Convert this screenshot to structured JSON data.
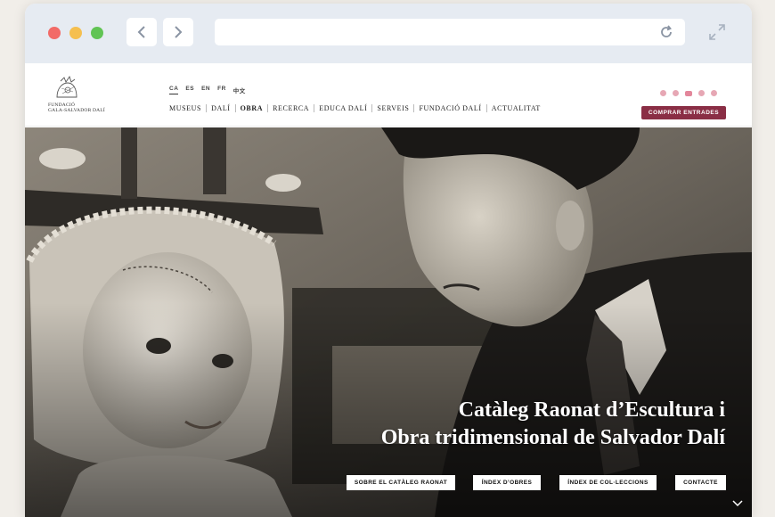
{
  "browser": {
    "icons": [
      "chevron-left-icon",
      "chevron-right-icon",
      "reload-icon",
      "expand-icon"
    ]
  },
  "logo": {
    "line1": "FUNDACIÓ",
    "line2": "GALA-SALVADOR DALÍ"
  },
  "languages": [
    {
      "code": "CA",
      "active": true
    },
    {
      "code": "ES",
      "active": false
    },
    {
      "code": "EN",
      "active": false
    },
    {
      "code": "FR",
      "active": false
    },
    {
      "code": "中文",
      "active": false
    }
  ],
  "nav": [
    {
      "label": "MUSEUS",
      "active": false
    },
    {
      "label": "DALÍ",
      "active": false
    },
    {
      "label": "OBRA",
      "active": true
    },
    {
      "label": "RECERCA",
      "active": false
    },
    {
      "label": "EDUCA DALÍ",
      "active": false
    },
    {
      "label": "SERVEIS",
      "active": false
    },
    {
      "label": "FUNDACIÓ DALÍ",
      "active": false
    },
    {
      "label": "ACTUALITAT",
      "active": false
    }
  ],
  "socials": [
    "facebook-icon",
    "twitter-icon",
    "youtube-icon",
    "instagram-icon",
    "flickr-icon"
  ],
  "buy_button": "COMPRAR ENTRADES",
  "hero": {
    "title_line1": "Catàleg Raonat d’Escultura i",
    "title_line2": "Obra tridimensional de Salvador Dalí",
    "buttons": [
      "SOBRE EL CATÀLEG RAONAT",
      "ÍNDEX D’OBRES",
      "ÍNDEX DE COL·LECCIONS",
      "CONTACTE"
    ]
  },
  "colors": {
    "accent": "#8a2e45",
    "social": "#e6a7b4",
    "chrome": "#e6ebf2"
  }
}
